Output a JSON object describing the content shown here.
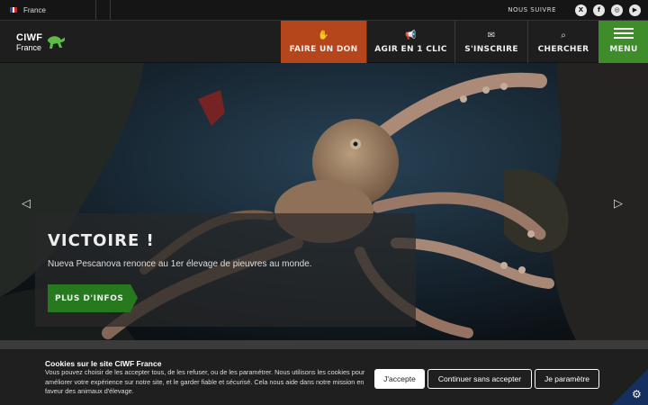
{
  "topbar": {
    "language": "France",
    "follow_label": "NOUS SUIVRE",
    "socials": [
      {
        "name": "x-icon",
        "glyph": "X"
      },
      {
        "name": "facebook-icon",
        "glyph": "f"
      },
      {
        "name": "instagram-icon",
        "glyph": "◎"
      },
      {
        "name": "youtube-icon",
        "glyph": "▶"
      }
    ]
  },
  "header": {
    "logo_line1": "CIWF",
    "logo_line2": "France",
    "nav": {
      "don": "FAIRE UN DON",
      "agir": "AGIR EN 1 CLIC",
      "inscrire": "S'INSCRIRE",
      "chercher": "CHERCHER",
      "menu": "MENU"
    }
  },
  "hero": {
    "title": "VICTOIRE !",
    "text": "Nueva Pescanova renonce au 1er élevage de pieuvres au monde.",
    "button": "PLUS D'INFOS",
    "prev_glyph": "◁",
    "next_glyph": "▷"
  },
  "cookie": {
    "title": "Cookies sur le site CIWF France",
    "text": "Vous pouvez choisir de les accepter tous, de les refuser, ou de les paramétrer. Nous utilisons les cookies pour améliorer votre expérience sur notre site, et le garder fiable et sécurisé. Cela nous aide dans notre mission en faveur des animaux d'élevage.",
    "accept": "J'accepte",
    "continue": "Continuer sans accepter",
    "settings": "Je paramètre"
  },
  "colors": {
    "donate": "#b5461c",
    "menu": "#3f8d2a",
    "cta": "#27791d",
    "cookie_gear": "#15305e"
  }
}
